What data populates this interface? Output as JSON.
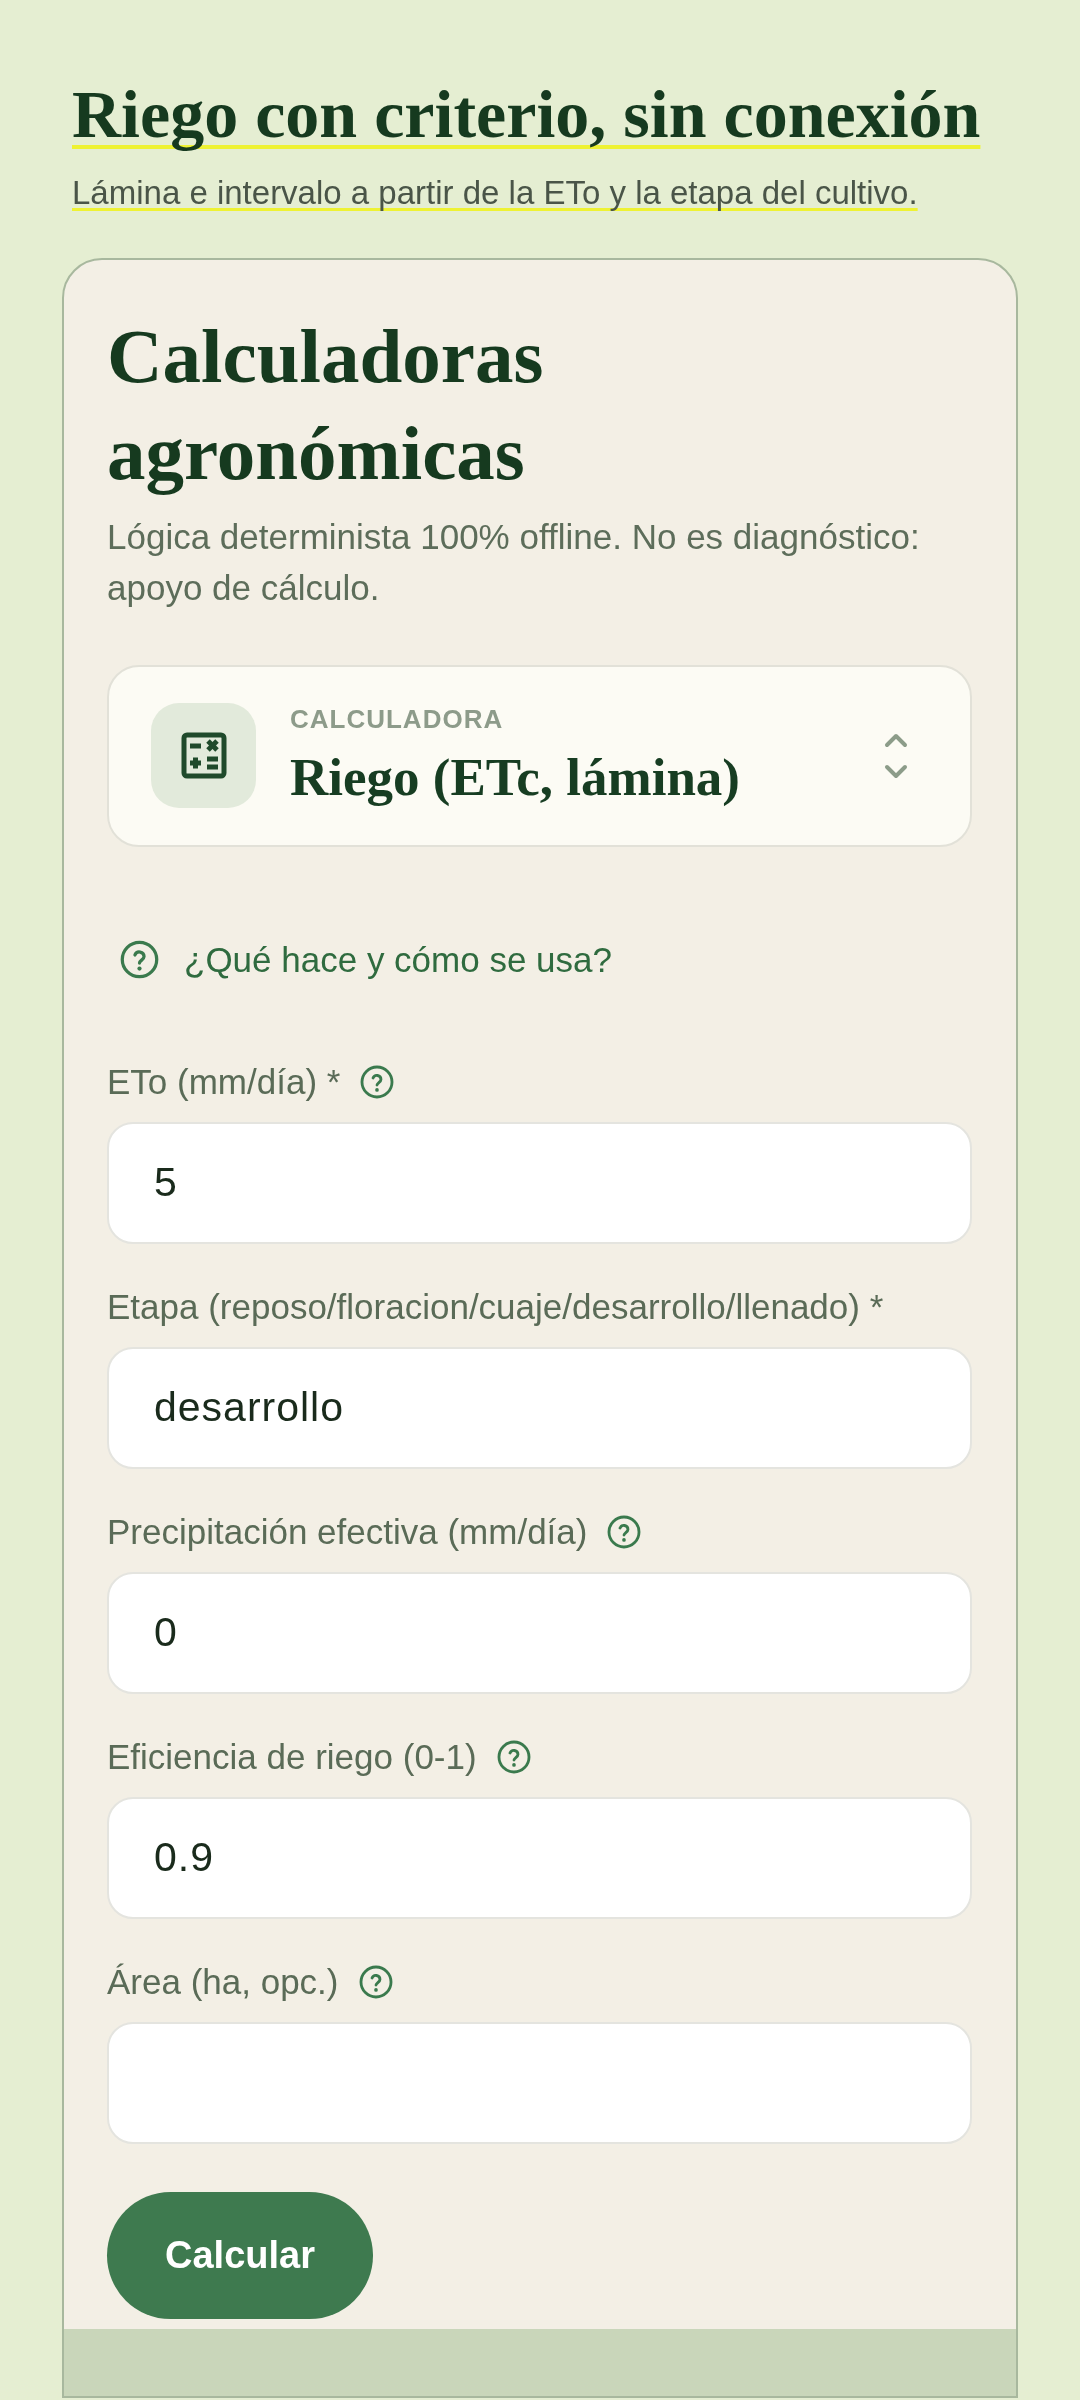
{
  "header": {
    "title": "Riego con criterio, sin conexión",
    "subtitle": "Lámina e intervalo a partir de la ETo y la etapa del cultivo."
  },
  "card": {
    "title": "Calculadoras agronómicas",
    "description": "Lógica determinista 100% offline. No es diagnóstico: apoyo de cálculo.",
    "selector": {
      "caption": "CALCULADORA",
      "value": "Riego (ETc, lámina)"
    },
    "help_link": "¿Qué hace y cómo se usa?",
    "fields": [
      {
        "label": "ETo (mm/día) *",
        "value": "5",
        "help": true
      },
      {
        "label": "Etapa (reposo/floracion/cuaje/desarrollo/llenado) *",
        "value": "desarrollo",
        "help": false
      },
      {
        "label": "Precipitación efectiva (mm/día)",
        "value": "0",
        "help": true
      },
      {
        "label": "Eficiencia de riego (0-1)",
        "value": "0.9",
        "help": true
      },
      {
        "label": "Área (ha, opc.)",
        "help": true
      }
    ],
    "submit_button": "Calcular"
  }
}
